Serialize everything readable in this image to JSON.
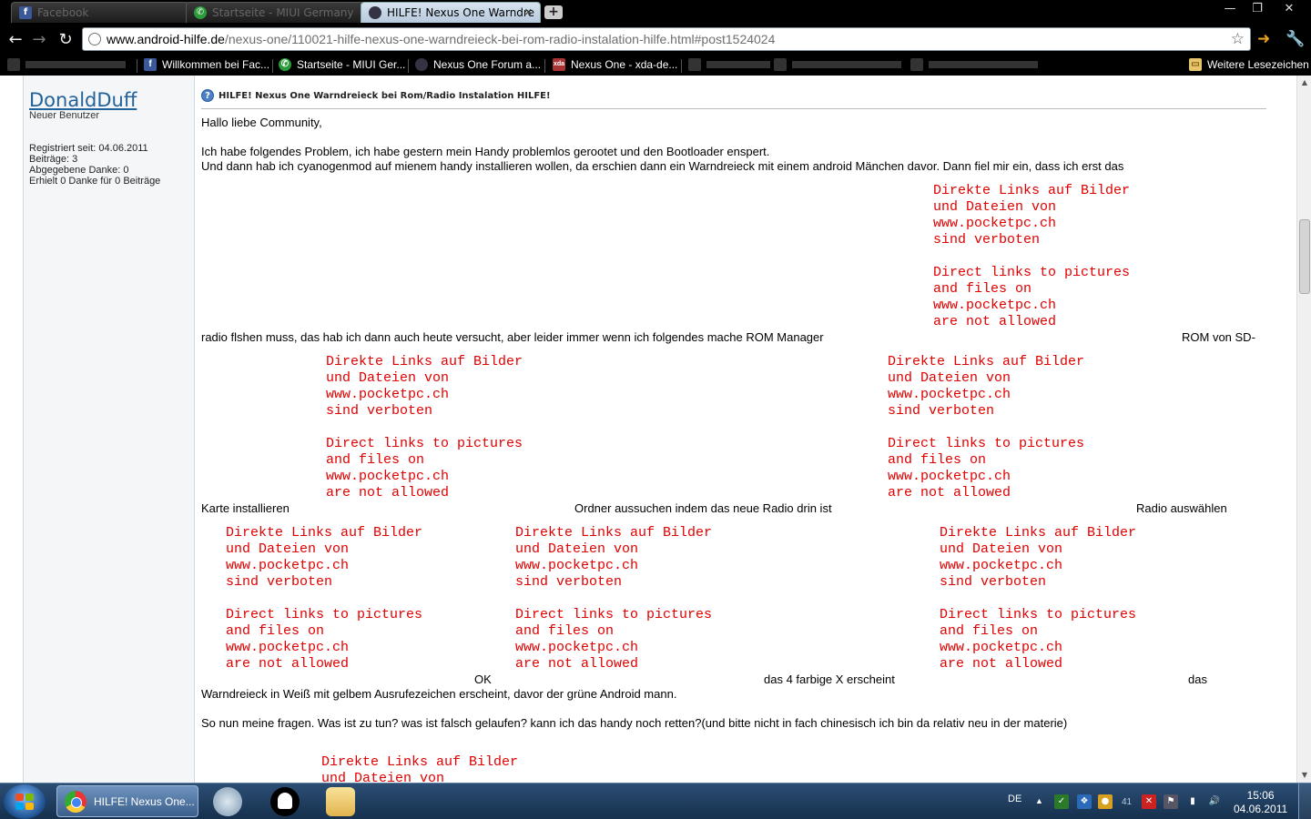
{
  "browser": {
    "tabs": [
      {
        "label": "Facebook",
        "icon": "facebook-icon",
        "active": false
      },
      {
        "label": "Startseite - MIUI Germany",
        "icon": "miui-icon",
        "active": false
      },
      {
        "label": "HILFE! Nexus One Warndre",
        "icon": "android-hilfe-icon",
        "active": true
      }
    ],
    "new_tab_label": "+",
    "window_controls": {
      "minimize": "—",
      "maximize": "❐",
      "close": "✕"
    },
    "url_domain": "www.android-hilfe.de",
    "url_path": "/nexus-one/110021-hilfe-nexus-one-warndreieck-bei-rom-radio-instalation-hilfe.html#post1524024",
    "bookmarks": [
      {
        "label": "",
        "icon": "blurred-bookmark-icon"
      },
      {
        "label": "Willkommen bei Fac...",
        "icon": "facebook-icon"
      },
      {
        "label": "Startseite - MIUI Ger...",
        "icon": "miui-icon"
      },
      {
        "label": "Nexus One Forum a...",
        "icon": "android-hilfe-icon"
      },
      {
        "label": "Nexus One - xda-de...",
        "icon": "xda-icon"
      },
      {
        "label": "",
        "icon": "blurred-bookmark-icon"
      },
      {
        "label": "",
        "icon": "blurred-bookmark-icon"
      },
      {
        "label": "",
        "icon": "blurred-bookmark-icon"
      }
    ],
    "other_bookmarks": "Weitere Lesezeichen"
  },
  "user": {
    "name": "DonaldDuff",
    "title": "Neuer Benutzer",
    "info": [
      "Registriert seit: 04.06.2011",
      "Beiträge: 3",
      "Abgegebene Danke: 0",
      "Erhielt 0 Danke für 0 Beiträge"
    ]
  },
  "post": {
    "title": "HILFE! Nexus One Warndreieck bei Rom/Radio Instalation HILFE!",
    "greeting": "Hallo liebe Community,",
    "line1": "Ich habe folgendes Problem, ich habe gestern mein Handy problemlos gerootet und den Bootloader enspert.",
    "line2": "Und dann hab ich cyanogenmod auf mienem handy installieren wollen, da erschien dann ein Warndreieck mit einem android Mänchen davor. Dann fiel mir ein, dass ich erst das",
    "line3a": "radio flshen muss, das hab ich dann auch heute versucht, aber leider immer wenn ich folgendes mache ROM Manager",
    "line3b": "ROM von SD-",
    "line4a": "Karte installieren",
    "line4b": "Ordner aussuchen indem das neue Radio drin ist",
    "line4c": "Radio auswählen",
    "line5a": "OK",
    "line5b": "das 4 farbige X erscheint",
    "line5c": "das",
    "line6": "Warndreieck in Weiß mit gelbem Ausrufezeichen erscheint, davor der grüne Android mann.",
    "line7": "So nun meine fragen. Was ist zu tun? was ist falsch gelaufen? kann ich das handy noch retten?(und bitte nicht in fach chinesisch ich bin da relativ neu in der materie)",
    "warning": "Direkte Links auf Bilder\nund Dateien von\nwww.pocketpc.ch\nsind verboten\n\nDirect links to pictures\nand files on\nwww.pocketpc.ch\nare not allowed",
    "warning_partial": "Direkte Links auf Bilder\nund Dateien von"
  },
  "taskbar": {
    "active_window": "HILFE! Nexus One...",
    "language": "DE",
    "tray_number": "41",
    "time": "15:06",
    "date": "04.06.2011"
  }
}
